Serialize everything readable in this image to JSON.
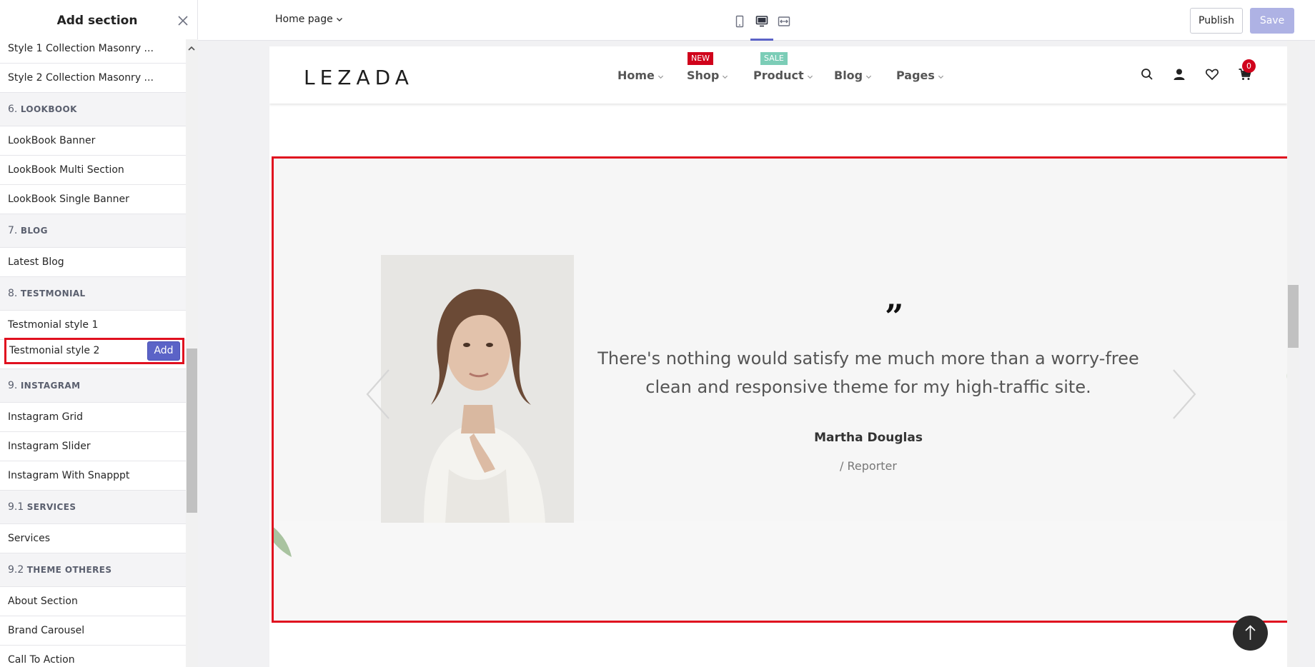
{
  "sidebar": {
    "title": "Add section",
    "items": [
      {
        "type": "item",
        "label": "Style 1 Collection Masonry ..."
      },
      {
        "type": "item",
        "label": "Style 2 Collection Masonry ..."
      },
      {
        "type": "head",
        "num": "6.",
        "label": "LOOKBOOK"
      },
      {
        "type": "item",
        "label": "LookBook Banner"
      },
      {
        "type": "item",
        "label": "LookBook Multi Section"
      },
      {
        "type": "item",
        "label": "LookBook Single Banner"
      },
      {
        "type": "head",
        "num": "7.",
        "label": "BLOG"
      },
      {
        "type": "item",
        "label": "Latest Blog"
      },
      {
        "type": "head",
        "num": "8.",
        "label": "TESTMONIAL"
      },
      {
        "type": "item",
        "label": "Testmonial style 1"
      },
      {
        "type": "item",
        "label": "Testmonial style 2"
      },
      {
        "type": "head",
        "num": "9.",
        "label": "INSTAGRAM"
      },
      {
        "type": "item",
        "label": "Instagram Grid"
      },
      {
        "type": "item",
        "label": "Instagram Slider"
      },
      {
        "type": "item",
        "label": "Instagram With Snapppt"
      },
      {
        "type": "head",
        "num": "9.1",
        "label": "SERVICES"
      },
      {
        "type": "item",
        "label": "Services"
      },
      {
        "type": "head",
        "num": "9.2",
        "label": "THEME OTHERES"
      },
      {
        "type": "item",
        "label": "About Section"
      },
      {
        "type": "item",
        "label": "Brand Carousel"
      },
      {
        "type": "item",
        "label": "Call To Action"
      }
    ],
    "add_label": "Add"
  },
  "topbar": {
    "page_select": "Home page",
    "publish_label": "Publish",
    "save_label": "Save"
  },
  "store": {
    "logo": "LEZADA",
    "nav": [
      {
        "label": "Home"
      },
      {
        "label": "Shop",
        "badge": "NEW"
      },
      {
        "label": "Product",
        "badge": "SALE"
      },
      {
        "label": "Blog"
      },
      {
        "label": "Pages"
      }
    ],
    "cart_count": "0"
  },
  "testimonial": {
    "quote_mark": "”",
    "quote": "There's nothing would satisfy me much more than a worry-free clean and responsive theme for my high-traffic site.",
    "author": "Martha Douglas",
    "role": "/ Reporter"
  },
  "colors": {
    "accent": "#5b63c7",
    "highlight": "#e0101f",
    "badge_new": "#d0021b",
    "badge_sale": "#7ccdb7"
  }
}
